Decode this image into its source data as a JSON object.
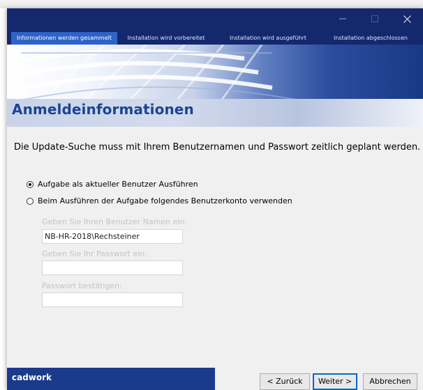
{
  "window": {
    "controls": [
      "minimize-icon",
      "maximize-icon",
      "close-icon"
    ]
  },
  "steps": [
    {
      "label": "Informationen werden gesammelt",
      "active": true
    },
    {
      "label": "Installation wird vorbereitet",
      "active": false
    },
    {
      "label": "Installation wird ausgeführt",
      "active": false
    },
    {
      "label": "Installation abgeschlossen",
      "active": false
    }
  ],
  "page": {
    "title": "Anmeldeinformationen",
    "description": "Die Update-Suche muss mit Ihrem Benutzernamen und Passwort zeitlich geplant werden."
  },
  "options": {
    "current_user_label": "Aufgabe als aktueller Benutzer Ausführen",
    "other_user_label": "Beim Ausführen der Aufgabe folgendes Benutzerkonto verwenden",
    "selected": "current_user"
  },
  "fields": {
    "username_label": "Geben Sie Ihren Benutzer Namen ein:",
    "username_value": "NB-HR-2018\\Rechsteiner",
    "password_label": "Geben Sie Ihr Passwort ein:",
    "password_value": "",
    "confirm_label": "Passwort bestätigen:",
    "confirm_value": ""
  },
  "footer": {
    "brand": "cadwork",
    "back_label": "< Zurück",
    "next_label": "Weiter >",
    "cancel_label": "Abbrechen"
  },
  "colors": {
    "titlebar": "#14286e",
    "active_tab": "#2e63c8",
    "title_text": "#1b4592",
    "brand_bar": "#1b3a8c"
  }
}
